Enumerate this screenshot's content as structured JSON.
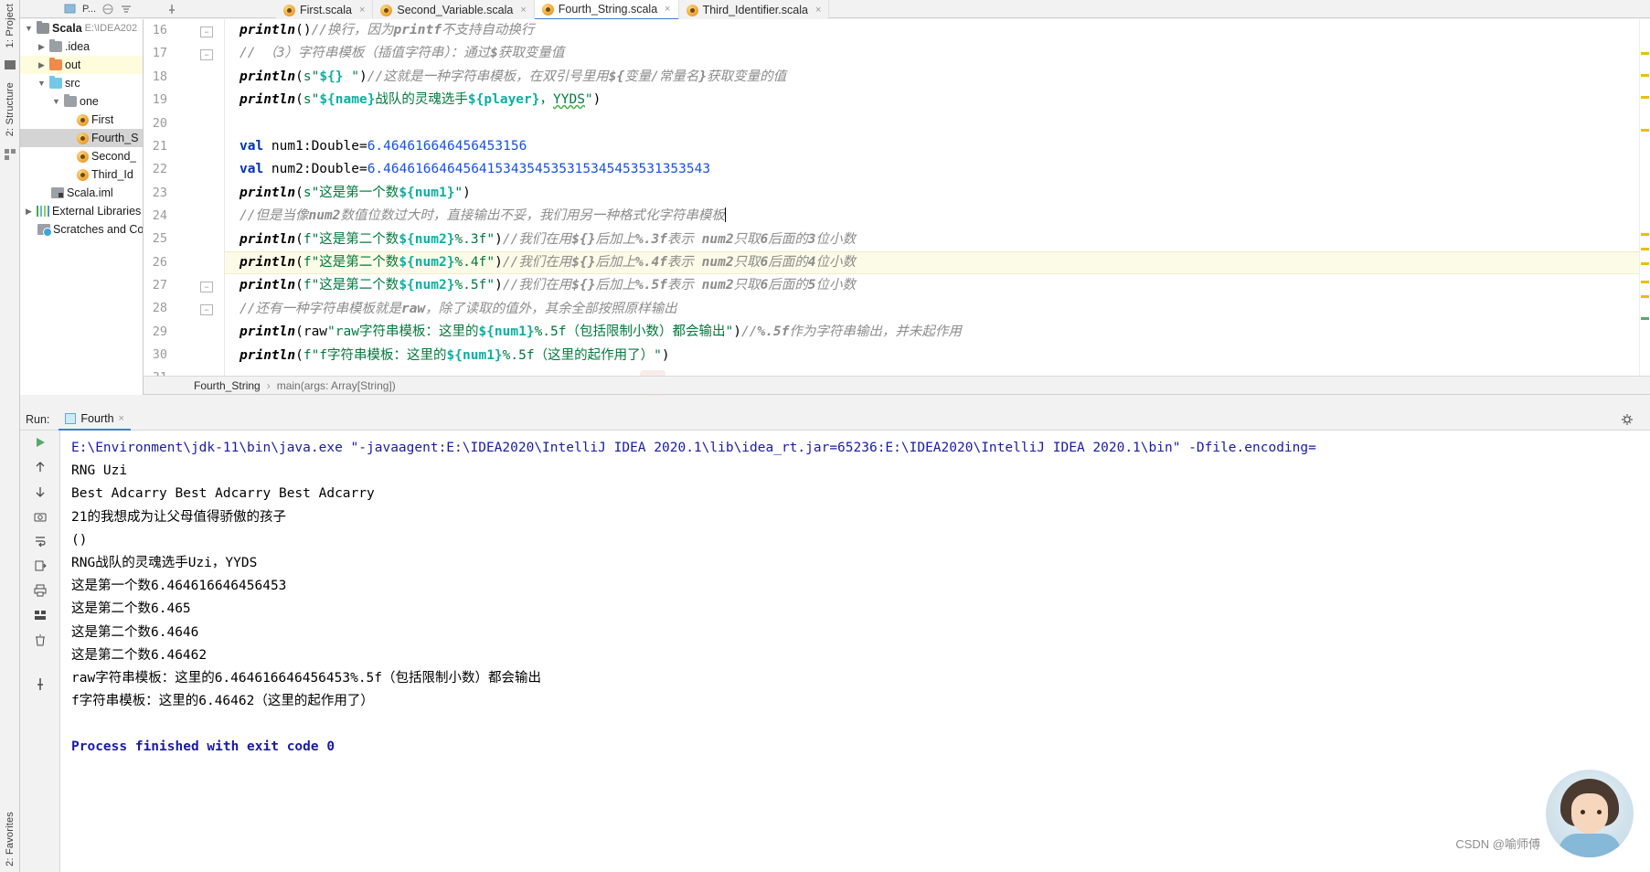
{
  "window": {
    "ide": "IntelliJ IDEA"
  },
  "left_strips": {
    "top_items": [
      {
        "label": "1: Project",
        "icon": "project-icon"
      },
      {
        "label": "2: Structure",
        "icon": "structure-icon"
      }
    ],
    "bottom_items": [
      {
        "label": "2: Favorites",
        "icon": "favorites-icon"
      }
    ]
  },
  "toolbar": {
    "project_select_label": "P...",
    "icons": [
      "project-view-icon",
      "collapse-all-icon",
      "settings-icon",
      "pin-icon"
    ]
  },
  "tabs": [
    {
      "label": "First.scala",
      "active": false,
      "icon": "scala-file-icon"
    },
    {
      "label": "Second_Variable.scala",
      "active": false,
      "icon": "scala-file-icon"
    },
    {
      "label": "Fourth_String.scala",
      "active": true,
      "icon": "scala-file-icon"
    },
    {
      "label": "Third_Identifier.scala",
      "active": false,
      "icon": "scala-file-icon"
    }
  ],
  "project_tree": [
    {
      "label": "Scala",
      "path": "E:\\IDEA202",
      "depth": 0,
      "arrow": "down",
      "icon": "module-folder",
      "bold": true,
      "state": "none"
    },
    {
      "label": ".idea",
      "path": "",
      "depth": 1,
      "arrow": "right",
      "icon": "folder-gray",
      "bold": false,
      "state": "none"
    },
    {
      "label": "out",
      "path": "",
      "depth": 1,
      "arrow": "right",
      "icon": "folder-orange",
      "bold": false,
      "state": "yellow"
    },
    {
      "label": "src",
      "path": "",
      "depth": 1,
      "arrow": "down",
      "icon": "folder-blue",
      "bold": false,
      "state": "none"
    },
    {
      "label": "one",
      "path": "",
      "depth": 2,
      "arrow": "down",
      "icon": "package-folder",
      "bold": false,
      "state": "none"
    },
    {
      "label": "First",
      "path": "",
      "depth": 3,
      "arrow": "none",
      "icon": "scala-class-icon",
      "bold": false,
      "state": "none"
    },
    {
      "label": "Fourth_S",
      "path": "",
      "depth": 3,
      "arrow": "none",
      "icon": "scala-class-icon",
      "bold": false,
      "state": "selected"
    },
    {
      "label": "Second_",
      "path": "",
      "depth": 3,
      "arrow": "none",
      "icon": "scala-class-icon",
      "bold": false,
      "state": "none"
    },
    {
      "label": "Third_Id",
      "path": "",
      "depth": 3,
      "arrow": "none",
      "icon": "scala-class-icon",
      "bold": false,
      "state": "none"
    },
    {
      "label": "Scala.iml",
      "path": "",
      "depth": 2,
      "arrow": "none",
      "icon": "iml-file-icon",
      "bold": false,
      "state": "none"
    },
    {
      "label": "External Libraries",
      "path": "",
      "depth": 0,
      "arrow": "right",
      "icon": "libraries-icon",
      "bold": false,
      "state": "none"
    },
    {
      "label": "Scratches and Co",
      "path": "",
      "depth": 0,
      "arrow": "none",
      "icon": "scratches-icon",
      "bold": false,
      "state": "none"
    }
  ],
  "editor": {
    "first_visible_line": 16,
    "last_visible_line": 31,
    "caret_line": 24,
    "lines": [
      {
        "n": 16,
        "fold": "minus",
        "text": "println()//换行，因为printf不支持自动换行"
      },
      {
        "n": 17,
        "fold": "minus",
        "text": "// （3）字符串模板（插值字符串）：通过$获取变量值"
      },
      {
        "n": 18,
        "fold": "none",
        "text": "println(s\"${} \")//这就是一种字符串模板，在双引号里用${变量/常量名}获取变量的值"
      },
      {
        "n": 19,
        "fold": "none",
        "text": "println(s\"${name}战队的灵魂选手${player}，YYDS\")"
      },
      {
        "n": 20,
        "fold": "none",
        "text": ""
      },
      {
        "n": 21,
        "fold": "none",
        "text": "val num1:Double=6.464616646456453156"
      },
      {
        "n": 22,
        "fold": "none",
        "text": "val num2:Double=6.46461664645641534354535315345453531353543"
      },
      {
        "n": 23,
        "fold": "none",
        "text": "println(s\"这是第一个数${num1}\")"
      },
      {
        "n": 24,
        "fold": "none",
        "text": "//但是当像num2数值位数过大时，直接输出不妥，我们用另一种格式化字符串模板"
      },
      {
        "n": 25,
        "fold": "none",
        "text": "println(f\"这是第二个数${num2}%.3f\")//我们在用${}后加上%.3f表示 num2只取6后面的3位小数"
      },
      {
        "n": 26,
        "fold": "none",
        "text": "println(f\"这是第二个数${num2}%.4f\")//我们在用${}后加上%.4f表示 num2只取6后面的4位小数"
      },
      {
        "n": 27,
        "fold": "minus",
        "text": "println(f\"这是第二个数${num2}%.5f\")//我们在用${}后加上%.5f表示 num2只取6后面的5位小数"
      },
      {
        "n": 28,
        "fold": "minus",
        "text": "//还有一种字符串模板就是raw，除了读取的值外，其余全部按照原样输出"
      },
      {
        "n": 29,
        "fold": "none",
        "text": "println(raw\"raw字符串模板：这里的${num1}%.5f（包括限制小数）都会输出\")//%.5f作为字符串输出，并未起作用"
      },
      {
        "n": 30,
        "fold": "none",
        "text": "println(f\"f字符串模板：这里的${num1}%.5f（这里的起作用了）\")"
      },
      {
        "n": 31,
        "fold": "none",
        "text": ""
      }
    ]
  },
  "breadcrumb": {
    "file": "Fourth_String",
    "separator": "›",
    "method": "main(args: Array[String])"
  },
  "run_panel": {
    "run_label": "Run:",
    "tab_label": "Fourth",
    "close_label": "×",
    "gear_icon": "gear-icon",
    "side_buttons": [
      "rerun-icon",
      "scroll-up-icon",
      "scroll-down-icon",
      "camera-icon",
      "soft-wrap-icon",
      "export-icon",
      "print-icon",
      "grid-icon",
      "trash-icon",
      "pin-icon"
    ],
    "output": [
      {
        "text": "E:\\Environment\\jdk-11\\bin\\java.exe \"-javaagent:E:\\IDEA2020\\IntelliJ IDEA 2020.1\\lib\\idea_rt.jar=65236:E:\\IDEA2020\\IntelliJ IDEA 2020.1\\bin\" -Dfile.encoding=",
        "style": "blue"
      },
      {
        "text": "RNG  Uzi",
        "style": "plain"
      },
      {
        "text": "Best Adcarry  Best Adcarry  Best Adcarry",
        "style": "plain"
      },
      {
        "text": "21的我想成为让父母值得骄傲的孩子",
        "style": "plain"
      },
      {
        "text": "()",
        "style": "plain"
      },
      {
        "text": "RNG战队的灵魂选手Uzi，YYDS",
        "style": "plain"
      },
      {
        "text": "这是第一个数6.464616646456453",
        "style": "plain"
      },
      {
        "text": "这是第二个数6.465",
        "style": "plain"
      },
      {
        "text": "这是第二个数6.4646",
        "style": "plain"
      },
      {
        "text": "这是第二个数6.46462",
        "style": "plain"
      },
      {
        "text": "raw字符串模板：这里的6.464616646456453%.5f（包括限制小数）都会输出",
        "style": "plain"
      },
      {
        "text": "f字符串模板：这里的6.46462（这里的起作用了）",
        "style": "plain"
      },
      {
        "text": "",
        "style": "plain"
      },
      {
        "text": "Process finished with exit code 0",
        "style": "blue"
      }
    ]
  },
  "overlay": {
    "watermark": "CSDN @喻师傅",
    "avatar_name": "avatar"
  },
  "colors": {
    "accent": "#3d7fd1",
    "keyword": "#0033b3",
    "string": "#007a3d",
    "number": "#1750eb",
    "comment": "#8c8c8c",
    "interp": "#0bb0a0",
    "console_blue": "#1a1aa6",
    "highlight_row": "#fcfbe8"
  }
}
